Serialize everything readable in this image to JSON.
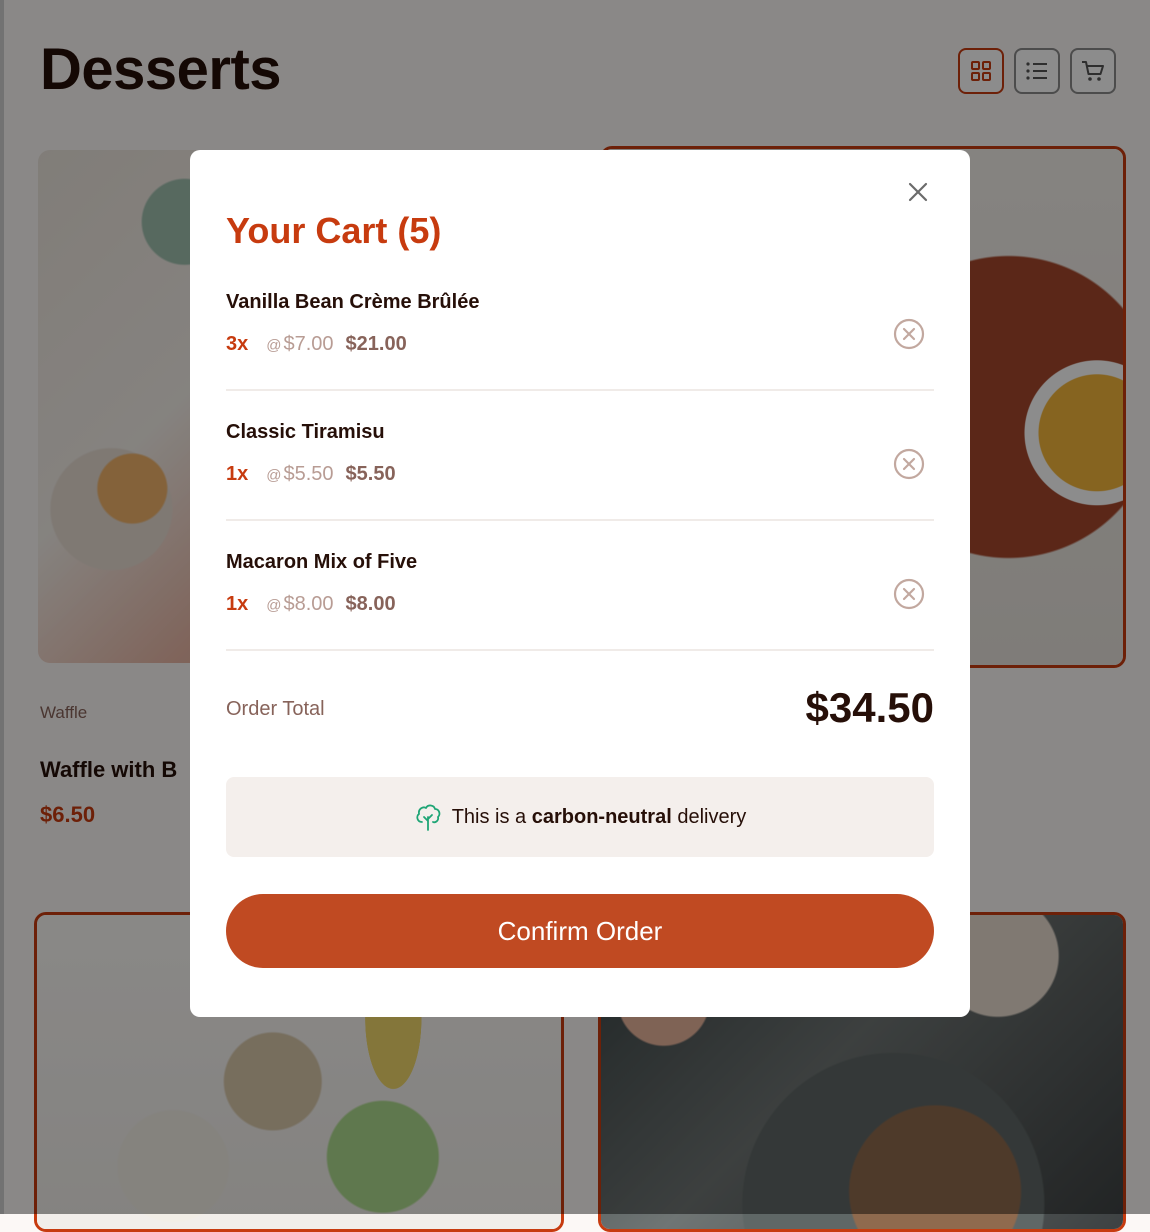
{
  "page": {
    "title": "Desserts"
  },
  "toolbar": {
    "buttons": [
      {
        "icon": "grid-icon",
        "active": true
      },
      {
        "icon": "list-icon",
        "active": false
      },
      {
        "icon": "cart-icon",
        "active": false
      }
    ]
  },
  "background_card": {
    "category": "Waffle",
    "name": "Waffle with B",
    "price": "$6.50"
  },
  "cart": {
    "title": "Your Cart (5)",
    "items": [
      {
        "name": "Vanilla Bean Crème Brûlée",
        "qty": "3x",
        "at": "@",
        "unit_price": "$7.00",
        "line_total": "$21.00"
      },
      {
        "name": "Classic Tiramisu",
        "qty": "1x",
        "at": "@",
        "unit_price": "$5.50",
        "line_total": "$5.50"
      },
      {
        "name": "Macaron Mix of Five",
        "qty": "1x",
        "at": "@",
        "unit_price": "$8.00",
        "line_total": "$8.00"
      }
    ],
    "total_label": "Order Total",
    "total_value": "$34.50",
    "carbon": {
      "prefix": "This is a",
      "bold": "carbon-neutral",
      "suffix": "delivery"
    },
    "confirm_label": "Confirm Order"
  },
  "colors": {
    "accent": "#c73b0f",
    "button": "#c04a22",
    "text_dark": "#260f08",
    "text_muted": "#87635a",
    "price_muted": "#b89c94"
  }
}
